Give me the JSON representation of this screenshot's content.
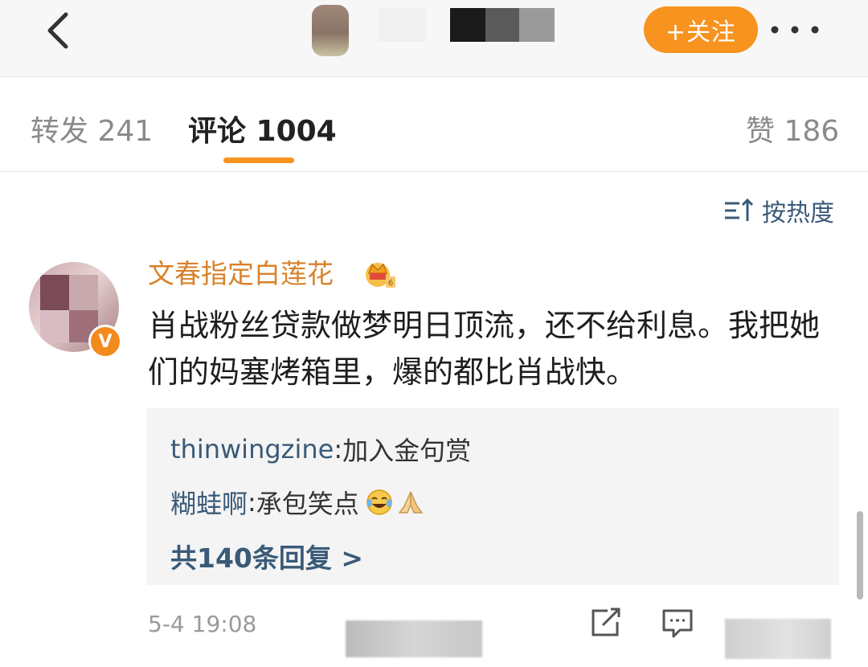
{
  "navbar": {
    "follow_label": "+关注",
    "more_icon": "more-dots-icon",
    "back_icon": "chevron-left-icon",
    "brand_color": "#f7931e"
  },
  "tabs": {
    "repost_label": "转发 241",
    "comment_label": "评论 1004",
    "like_label": "赞 186",
    "active": "comment"
  },
  "sort": {
    "label": "按热度",
    "icon": "sort-icon"
  },
  "comment": {
    "username": "文春指定白莲花",
    "badge_icon": "crown-badge-icon",
    "verified_label": "V",
    "text": "肖战粉丝贷款做梦明日顶流，还不给利息。我把她们的妈塞烤箱里，爆的都比肖战快。",
    "timestamp": "5-4 19:08",
    "username_color": "#d8822a"
  },
  "replies": {
    "items": [
      {
        "name": "thinwingzine",
        "text": "加入金句赏"
      },
      {
        "name": "糊蛙啊",
        "text": "承包笑点",
        "emojis": [
          "laugh-cry-emoji",
          "praying-hands-emoji"
        ]
      }
    ],
    "more_label": "共140条回复 >",
    "name_color": "#3a5a78"
  }
}
